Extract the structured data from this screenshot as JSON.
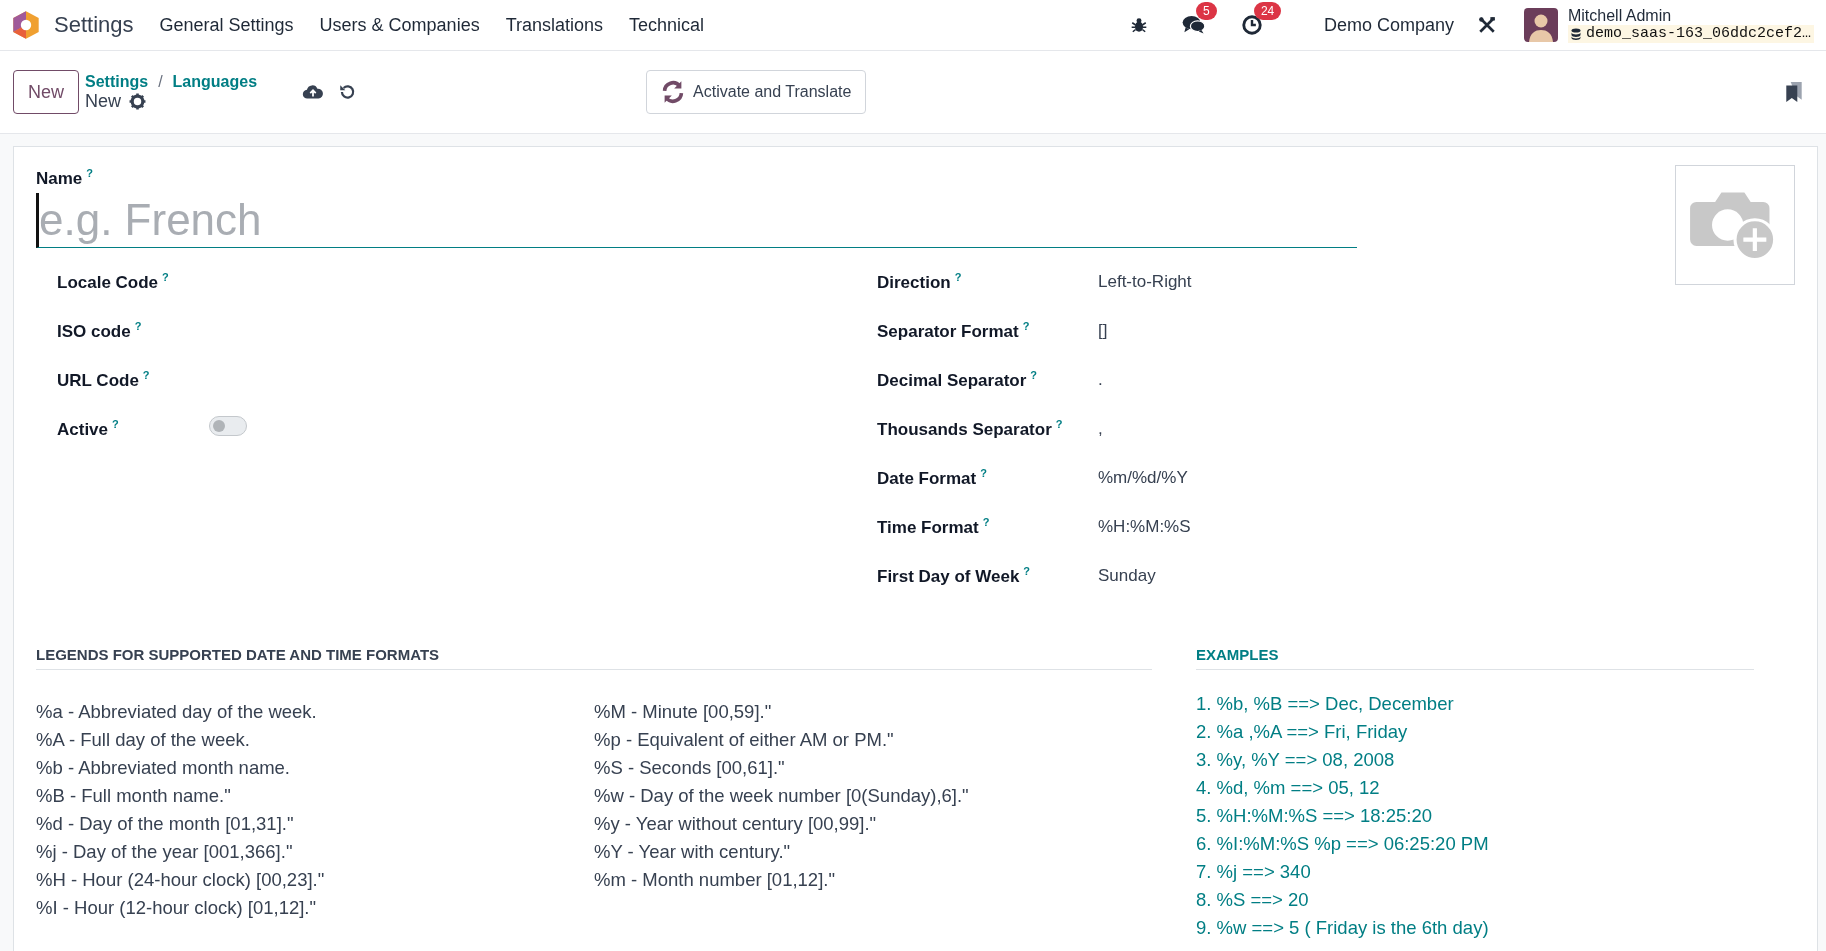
{
  "navbar": {
    "app_title": "Settings",
    "menu": [
      "General Settings",
      "Users & Companies",
      "Translations",
      "Technical"
    ],
    "messages_badge": "5",
    "activities_badge": "24",
    "company": "Demo Company",
    "user_name": "Mitchell Admin",
    "database": "demo_saas-163_06ddc2cef2…"
  },
  "control_panel": {
    "new_button": "New",
    "breadcrumbs": [
      "Settings",
      "Languages"
    ],
    "separator": "/",
    "record_name": "New",
    "action_button": "Activate and Translate"
  },
  "form": {
    "name_label": "Name",
    "name_help": "?",
    "name_placeholder": "e.g. French",
    "left_fields": [
      {
        "label": "Locale Code",
        "help": "?",
        "kind": "text"
      },
      {
        "label": "ISO code",
        "help": "?",
        "kind": "text"
      },
      {
        "label": "URL Code",
        "help": "?",
        "kind": "text"
      },
      {
        "label": "Active",
        "help": "?",
        "kind": "toggle",
        "on": false
      }
    ],
    "right_fields": [
      {
        "label": "Direction",
        "help": "?",
        "kind": "text",
        "value": "Left-to-Right"
      },
      {
        "label": "Separator Format",
        "help": "?",
        "kind": "text",
        "value": "[]"
      },
      {
        "label": "Decimal Separator",
        "help": "?",
        "kind": "text",
        "value": "."
      },
      {
        "label": "Thousands Separator",
        "help": "?",
        "kind": "text",
        "value": ","
      },
      {
        "label": "Date Format",
        "help": "?",
        "kind": "text",
        "value": "%m/%d/%Y"
      },
      {
        "label": "Time Format",
        "help": "?",
        "kind": "text",
        "value": "%H:%M:%S"
      },
      {
        "label": "First Day of Week",
        "help": "?",
        "kind": "text",
        "value": "Sunday"
      }
    ]
  },
  "legends": {
    "title": "LEGENDS FOR SUPPORTED DATE AND TIME FORMATS",
    "column_1": [
      "%a - Abbreviated day of the week.",
      "%A - Full day of the week.",
      "%b - Abbreviated month name.",
      "%B - Full month name.\"",
      "%d - Day of the month [01,31].\"",
      "%j - Day of the year [001,366].\"",
      "%H - Hour (24-hour clock) [00,23].\"",
      "%I - Hour (12-hour clock) [01,12].\""
    ],
    "column_2": [
      "%M - Minute [00,59].\"",
      "%p - Equivalent of either AM or PM.\"",
      "%S - Seconds [00,61].\"",
      "%w - Day of the week number [0(Sunday),6].\"",
      "%y - Year without century [00,99].\"",
      "%Y - Year with century.\"",
      "%m - Month number [01,12].\""
    ]
  },
  "examples": {
    "title": "EXAMPLES",
    "items": [
      "1. %b, %B ==> Dec, December",
      "2. %a ,%A ==> Fri, Friday",
      "3. %y, %Y ==> 08, 2008",
      "4. %d, %m ==> 05, 12",
      "5. %H:%M:%S ==> 18:25:20",
      "6. %I:%M:%S %p ==> 06:25:20 PM",
      "7. %j ==> 340",
      "8. %S ==> 20",
      "9. %w ==> 5 ( Friday is the 6th day)"
    ]
  }
}
